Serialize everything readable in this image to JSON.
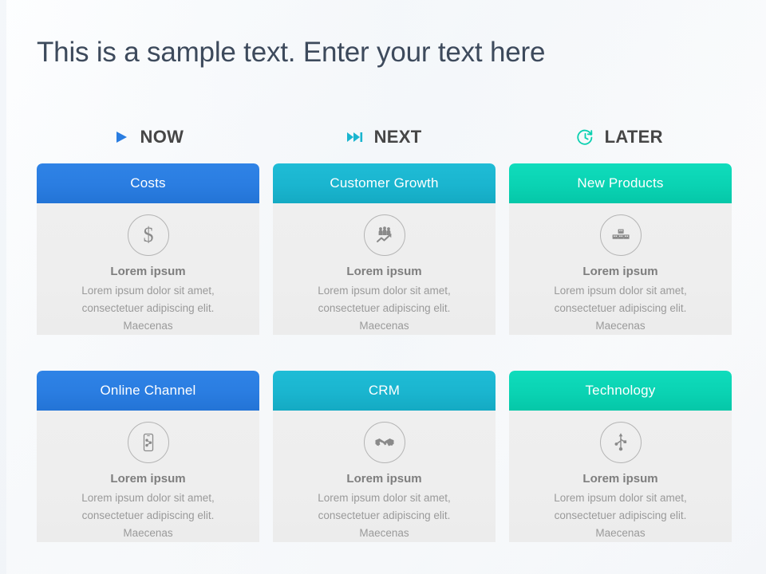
{
  "slide": {
    "title": "This is a sample text. Enter your text here",
    "title_color": "#3d4a5c",
    "background_color": "#fafbfc"
  },
  "columns": [
    {
      "label": "NOW",
      "icon": "play-triangle-icon",
      "accent": "#2a7de1"
    },
    {
      "label": "NEXT",
      "icon": "fast-forward-icon",
      "accent": "#1ab5cf"
    },
    {
      "label": "LATER",
      "icon": "clock-refresh-icon",
      "accent": "#0ad0b0"
    }
  ],
  "cards": [
    {
      "title": "Costs",
      "icon": "dollar-sign-icon",
      "header_color": "#2a7de1",
      "header_color_dark": "#1f6fd6",
      "subtitle": "Lorem ipsum",
      "body": "Lorem ipsum dolor sit amet, consectetuer adipiscing elit. Maecenas"
    },
    {
      "title": "Customer Growth",
      "icon": "people-growth-chart-icon",
      "header_color": "#1ab5cf",
      "header_color_dark": "#14a8c4",
      "subtitle": "Lorem ipsum",
      "body": "Lorem ipsum dolor sit amet, consectetuer adipiscing elit. Maecenas"
    },
    {
      "title": "New Products",
      "icon": "stacked-boxes-icon",
      "header_color": "#0ad3b3",
      "header_color_dark": "#06c8aa",
      "subtitle": "Lorem ipsum",
      "body": "Lorem ipsum dolor sit amet, consectetuer adipiscing elit. Maecenas"
    },
    {
      "title": "Online Channel",
      "icon": "mobile-share-icon",
      "header_color": "#2a7de1",
      "header_color_dark": "#1f6fd6",
      "subtitle": "Lorem ipsum",
      "body": "Lorem ipsum dolor sit amet, consectetuer adipiscing elit. Maecenas"
    },
    {
      "title": "CRM",
      "icon": "handshake-icon",
      "header_color": "#1ab5cf",
      "header_color_dark": "#14a8c4",
      "subtitle": "Lorem ipsum",
      "body": "Lorem ipsum dolor sit amet, consectetuer adipiscing elit. Maecenas"
    },
    {
      "title": "Technology",
      "icon": "usb-symbol-icon",
      "header_color": "#0ad3b3",
      "header_color_dark": "#06c8aa",
      "subtitle": "Lorem ipsum",
      "body": "Lorem ipsum dolor sit amet, consectetuer adipiscing elit. Maecenas"
    }
  ]
}
